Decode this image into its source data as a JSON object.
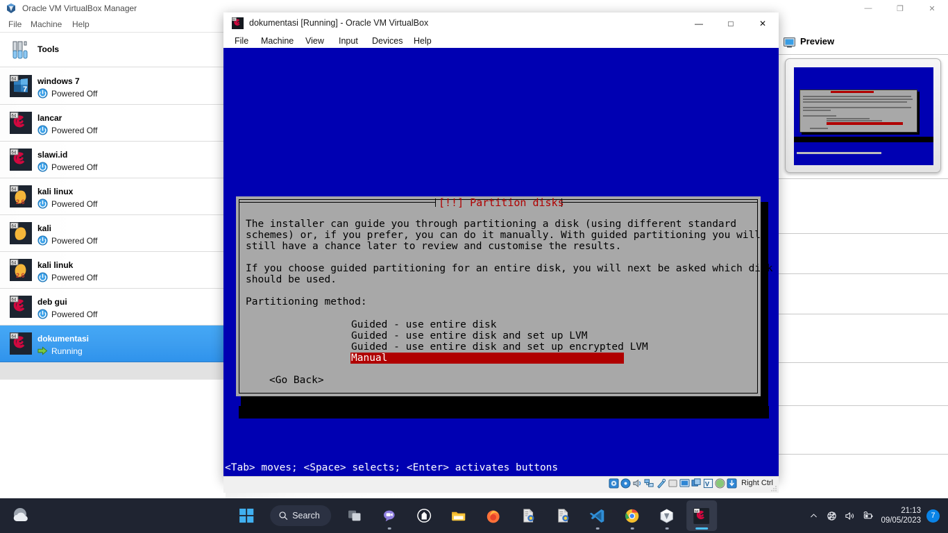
{
  "manager": {
    "title": "Oracle VM VirtualBox Manager",
    "title_icon": "virtualbox-logo-icon",
    "menus": [
      {
        "label": "File"
      },
      {
        "label": "Machine"
      },
      {
        "label": "Help"
      }
    ],
    "window_controls": {
      "minimize": "—",
      "restore": "❐",
      "close": "✕"
    },
    "tools": {
      "label": "Tools",
      "icon": "tools-wrench-icon"
    },
    "machines": [
      {
        "name": "windows 7",
        "state": "Powered Off",
        "os_icon": "windows7-64-icon",
        "state_icon": "power-off-icon"
      },
      {
        "name": "lancar",
        "state": "Powered Off",
        "os_icon": "debian-64-icon",
        "state_icon": "power-off-icon"
      },
      {
        "name": "slawi.id",
        "state": "Powered Off",
        "os_icon": "debian-64-icon",
        "state_icon": "power-off-icon"
      },
      {
        "name": "kali linux",
        "state": "Powered Off",
        "os_icon": "linux26-64-icon",
        "state_icon": "power-off-icon"
      },
      {
        "name": "kali",
        "state": "Powered Off",
        "os_icon": "linux-64-icon",
        "state_icon": "power-off-icon"
      },
      {
        "name": "kali linuk",
        "state": "Powered Off",
        "os_icon": "linux26-64-icon",
        "state_icon": "power-off-icon"
      },
      {
        "name": "deb gui",
        "state": "Powered Off",
        "os_icon": "debian-64-icon",
        "state_icon": "power-off-icon"
      },
      {
        "name": "dokumentasi",
        "state": "Running",
        "os_icon": "debian-64-icon",
        "state_icon": "running-arrow-icon",
        "selected": true
      }
    ],
    "preview": {
      "label": "Preview",
      "icon": "monitor-icon"
    }
  },
  "vm_window": {
    "title": "dokumentasi [Running] - Oracle VM VirtualBox",
    "title_icon": "debian-vm-icon",
    "menus": [
      {
        "label": "File"
      },
      {
        "label": "Machine"
      },
      {
        "label": "View"
      },
      {
        "label": "Input"
      },
      {
        "label": "Devices"
      },
      {
        "label": "Help"
      }
    ],
    "window_controls": {
      "minimize": "—",
      "maximize": "□",
      "close": "✕"
    },
    "statusbar": {
      "host_key": "Right Ctrl",
      "icons": [
        "hard-disk-icon",
        "optical-disk-icon",
        "audio-icon",
        "network-icon",
        "usb-icon",
        "shared-folders-icon",
        "display-icon",
        "recording-icon",
        "virtualization-icon",
        "mouse-integration-icon",
        "keyboard-icon"
      ]
    }
  },
  "installer": {
    "dialog_title": "[!!] Partition disks",
    "body_text": "The installer can guide you through partitioning a disk (using different standard\nschemes) or, if you prefer, you can do it manually. With guided partitioning you will\nstill have a chance later to review and customise the results.\n\nIf you choose guided partitioning for an entire disk, you will next be asked which disk\nshould be used.\n\nPartitioning method:",
    "options": [
      {
        "label": "Guided - use entire disk",
        "selected": false
      },
      {
        "label": "Guided - use entire disk and set up LVM",
        "selected": false
      },
      {
        "label": "Guided - use entire disk and set up encrypted LVM",
        "selected": false
      },
      {
        "label": "Manual",
        "selected": true
      }
    ],
    "go_back_button": "<Go Back>",
    "key_hints": "<Tab> moves; <Space> selects; <Enter> activates buttons",
    "colors": {
      "background": "#0000b2",
      "dialog": "#a8a8a8",
      "title_red": "#b00000",
      "selection_red": "#b00000"
    }
  },
  "taskbar": {
    "weather_icon": "weather-cloudy-icon",
    "start_label": "start-button",
    "search_placeholder": "Search",
    "items": [
      {
        "name": "start-button",
        "icon": "windows-logo-icon",
        "active": false,
        "running": false
      },
      {
        "name": "search-box",
        "icon": "search-icon",
        "active": false,
        "running": false
      },
      {
        "name": "task-view",
        "icon": "task-view-icon",
        "active": false,
        "running": false
      },
      {
        "name": "chat",
        "icon": "chat-icon",
        "active": false,
        "running": true
      },
      {
        "name": "widgets",
        "icon": "widgets-icon",
        "active": false,
        "running": false
      },
      {
        "name": "file-explorer",
        "icon": "folder-icon",
        "active": false,
        "running": false
      },
      {
        "name": "firefox",
        "icon": "firefox-icon",
        "active": false,
        "running": false
      },
      {
        "name": "document-1",
        "icon": "document-icon",
        "active": false,
        "running": false
      },
      {
        "name": "document-2",
        "icon": "document-icon",
        "active": false,
        "running": false
      },
      {
        "name": "visual-studio-code",
        "icon": "vscode-icon",
        "active": false,
        "running": true
      },
      {
        "name": "google-chrome",
        "icon": "chrome-icon",
        "active": false,
        "running": true
      },
      {
        "name": "virtualbox",
        "icon": "virtualbox-icon",
        "active": false,
        "running": true
      },
      {
        "name": "virtualbox-vm",
        "icon": "debian-vm-icon",
        "active": true,
        "running": true
      }
    ],
    "tray": {
      "chevron": "show-hidden-icons",
      "network": "network-globe-icon",
      "volume": "volume-icon",
      "battery": "battery-charging-icon",
      "time": "21:13",
      "date": "09/05/2023",
      "notification_count": "7"
    }
  }
}
